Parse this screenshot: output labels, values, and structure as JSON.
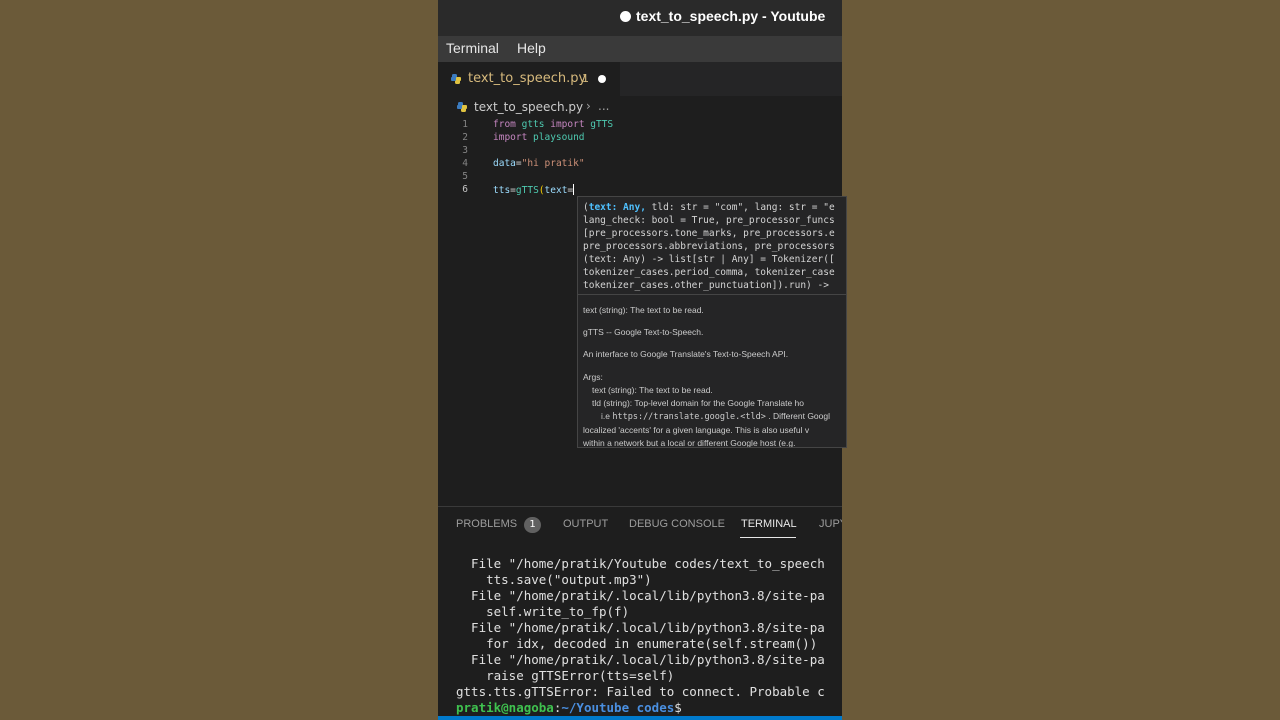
{
  "window": {
    "title": "text_to_speech.py - Youtube"
  },
  "menu": {
    "items": [
      "Terminal",
      "Help"
    ]
  },
  "tab": {
    "label": "text_to_speech.py",
    "badge": "1"
  },
  "breadcrumb": {
    "file": "text_to_speech.py",
    "separator": "›",
    "more": "..."
  },
  "code": {
    "lines": [
      {
        "n": "1",
        "tokens": [
          [
            "kw",
            "from "
          ],
          [
            "mod",
            "gtts "
          ],
          [
            "kw",
            "import "
          ],
          [
            "cls",
            "gTTS"
          ]
        ]
      },
      {
        "n": "2",
        "tokens": [
          [
            "kw",
            "import "
          ],
          [
            "mod",
            "playsound"
          ]
        ]
      },
      {
        "n": "3",
        "tokens": []
      },
      {
        "n": "4",
        "tokens": [
          [
            "var",
            "data"
          ],
          [
            "op",
            "="
          ],
          [
            "str",
            "\"hi pratik\""
          ]
        ]
      },
      {
        "n": "5",
        "tokens": []
      },
      {
        "n": "6",
        "tokens": [
          [
            "var",
            "tts"
          ],
          [
            "op",
            "="
          ],
          [
            "cls",
            "gTTS"
          ],
          [
            "paren",
            "("
          ],
          [
            "var",
            "text"
          ],
          [
            "op",
            "="
          ]
        ]
      }
    ],
    "active_line": "6"
  },
  "popup": {
    "signature_lines": [
      "(text: Any, tld: str = \"com\", lang: str = \"e",
      "lang_check: bool = True, pre_processor_funcs",
      "[pre_processors.tone_marks, pre_processors.e",
      "pre_processors.abbreviations, pre_processors",
      "(text: Any) -> list[str | Any] = Tokenizer([",
      "tokenizer_cases.period_comma, tokenizer_case",
      "tokenizer_cases.other_punctuation]).run) -> "
    ],
    "sig_highlight": "text: Any,",
    "doc": {
      "p1": "text (string): The text to be read.",
      "p2": "gTTS -- Google Text-to-Speech.",
      "p3": "An interface to Google Translate's Text-to-Speech API.",
      "args_title": "Args:",
      "arg1": "text (string): The text to be read.",
      "arg2": "tld (string): Top-level domain for the Google Translate ho",
      "arg3_prefix": "i.e",
      "arg3_code": "https://translate.google.<tld>",
      "arg3_suffix": ". Different Googl",
      "arg4": "localized 'accents' for a given language. This is also useful v",
      "arg5": "within a network but a local or different Google host (e.g."
    }
  },
  "panel": {
    "tabs": [
      "PROBLEMS",
      "OUTPUT",
      "DEBUG CONSOLE",
      "TERMINAL",
      "JUPY"
    ],
    "problems_count": "1",
    "active": "TERMINAL"
  },
  "terminal": {
    "lines": [
      "  File \"/home/pratik/Youtube codes/text_to_speech",
      "    tts.save(\"output.mp3\")",
      "  File \"/home/pratik/.local/lib/python3.8/site-pa",
      "    self.write_to_fp(f)",
      "  File \"/home/pratik/.local/lib/python3.8/site-pa",
      "    for idx, decoded in enumerate(self.stream())",
      "  File \"/home/pratik/.local/lib/python3.8/site-pa",
      "    raise gTTSError(tts=self)",
      "gtts.tts.gTTSError: Failed to connect. Probable c"
    ],
    "prompt": {
      "user": "pratik@nagoba",
      "sep": ":",
      "path": "~/Youtube codes",
      "symbol": "$"
    }
  },
  "colors": {
    "accent": "#007acc",
    "background": "#1e1e1e",
    "desktop": "#6b5a39"
  }
}
